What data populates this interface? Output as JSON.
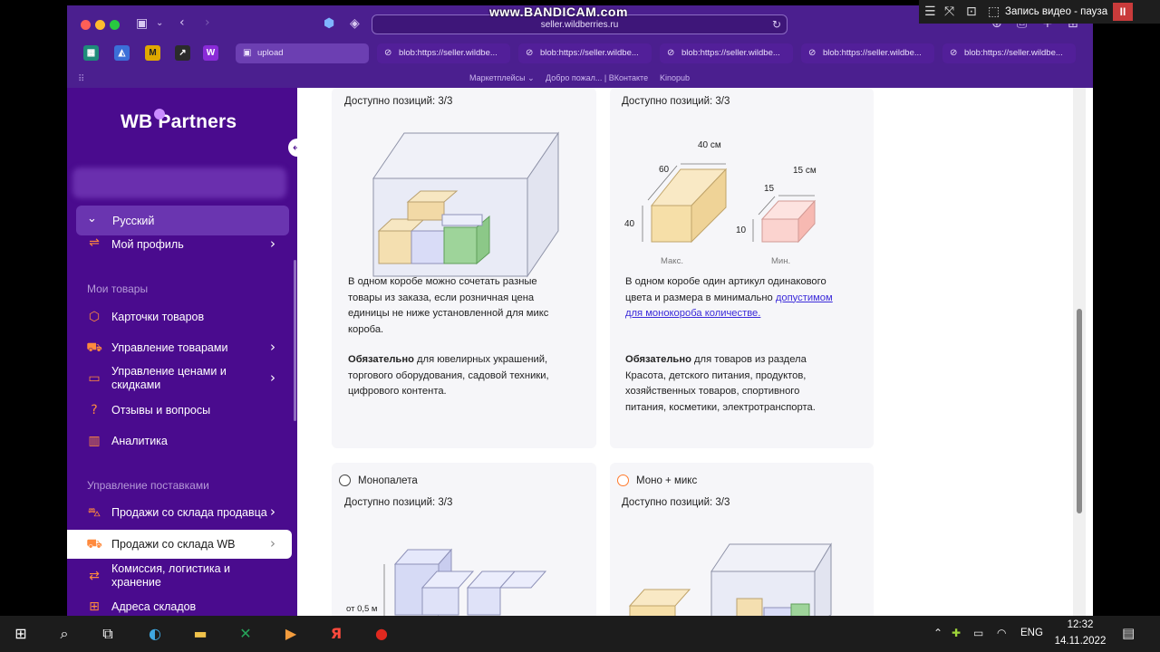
{
  "recorder": {
    "watermark": "www.BANDICAM.com",
    "label": "Запись видео - пауза"
  },
  "browser": {
    "url": "seller.wildberries.ru",
    "tabs": [
      {
        "label": "upload"
      },
      {
        "label": "blob:https://seller.wildbe..."
      },
      {
        "label": "blob:https://seller.wildbe..."
      },
      {
        "label": "blob:https://seller.wildbe..."
      },
      {
        "label": "blob:https://seller.wildbe..."
      },
      {
        "label": "blob:https://seller.wildbe..."
      }
    ],
    "bookmarks": [
      "Маркетплейсы",
      "Добро пожал... | ВКонтакте",
      "Kinopub"
    ]
  },
  "sidebar": {
    "logo": "WB Partners",
    "language": "Русский",
    "profile": "Мой профиль",
    "section_goods": "Мои товары",
    "section_supplies": "Управление поставками",
    "items": [
      {
        "label": "Карточки товаров",
        "icon": "box-icon"
      },
      {
        "label": "Управление товарами",
        "icon": "truck-icon"
      },
      {
        "label": "Управление ценами и скидками",
        "icon": "tag-icon"
      },
      {
        "label": "Отзывы и вопросы",
        "icon": "question-icon"
      },
      {
        "label": "Аналитика",
        "icon": "chart-icon"
      },
      {
        "label": "Продажи со склада продавца",
        "icon": "cart-icon"
      },
      {
        "label": "Продажи со склада WB",
        "icon": "truck-icon"
      },
      {
        "label": "Комиссия, логистика и хранение",
        "icon": "exchange-icon"
      },
      {
        "label": "Адреса складов",
        "icon": "map-icon"
      }
    ]
  },
  "content": {
    "mix_box": {
      "available": "Доступно позиций: 3/3",
      "desc": "В одном коробе можно сочетать разные товары из заказа, если розничная цена единицы не ниже установленной для микс короба.",
      "required_bold": "Обязательно",
      "required_rest": " для ювелирных украшений, торгового оборудования, садовой техники, цифрового контента."
    },
    "mono_box": {
      "available": "Доступно позиций: 3/3",
      "desc_before": "В одном коробе один артикул одинакового цвета и размера в минимально ",
      "desc_link": "допустимом для монокороба количестве.",
      "required_bold": "Обязательно",
      "required_rest": " для товаров из раздела Красота, детского питания, продуктов, хозяйственных товаров, спортивного питания, косметики, электротранспорта.",
      "dims": {
        "max_w": "40 см",
        "max_d": "60",
        "max_h": "40",
        "min_w": "15 см",
        "min_d": "15",
        "min_h": "10",
        "max_label": "Макс.",
        "min_label": "Мин."
      }
    },
    "monopallet": {
      "radio_label": "Монопалета",
      "available": "Доступно позиций: 3/3",
      "height_label": "от 0,5 м"
    },
    "mono_mix": {
      "radio_label": "Моно + микс",
      "available": "Доступно позиций: 3/3"
    }
  },
  "taskbar": {
    "language": "ENG",
    "time": "12:32",
    "date": "14.11.2022"
  }
}
